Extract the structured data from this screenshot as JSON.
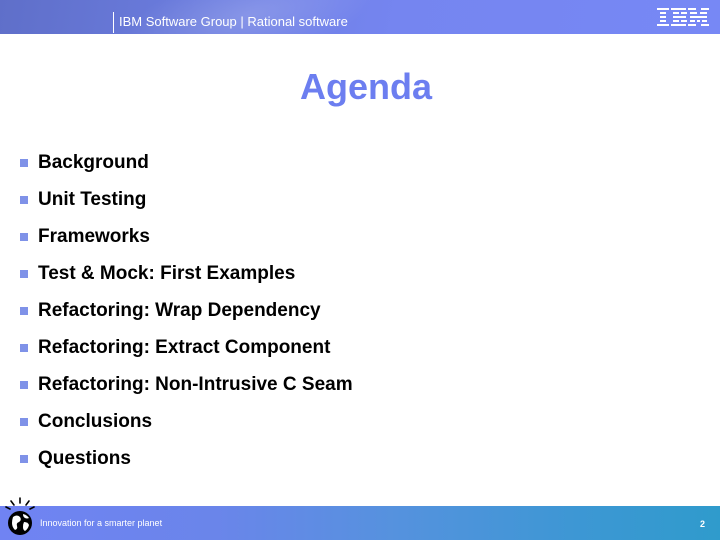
{
  "header": {
    "title": "IBM Software Group | Rational software",
    "logo": "IBM",
    "logo_icon": "ibm-logo-icon"
  },
  "slide": {
    "title": "Agenda",
    "bullet_color": "#7f92e8",
    "title_color": "#6c7ef0",
    "items": [
      {
        "label": "Background"
      },
      {
        "label": "Unit Testing"
      },
      {
        "label": "Frameworks"
      },
      {
        "label": "Test & Mock: First Examples"
      },
      {
        "label": "Refactoring: Wrap Dependency"
      },
      {
        "label": "Refactoring: Extract Component"
      },
      {
        "label": "Refactoring: Non-Intrusive C Seam"
      },
      {
        "label": "Conclusions"
      },
      {
        "label": "Questions"
      }
    ]
  },
  "footer": {
    "tagline": "Innovation for a smarter planet",
    "globe_icon": "smarter-planet-globe-icon",
    "page_number": "2"
  }
}
